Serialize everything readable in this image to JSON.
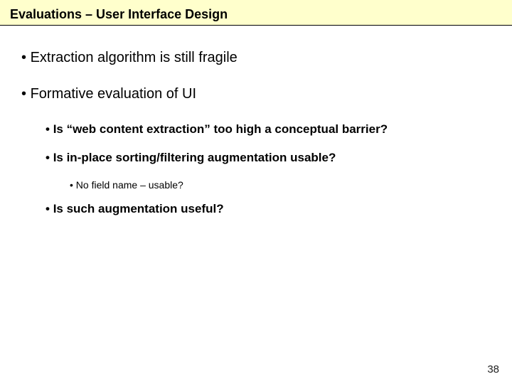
{
  "title": "Evaluations – User Interface Design",
  "bullets": {
    "a": "Extraction algorithm is still fragile",
    "b": "Formative evaluation of UI",
    "b1": "Is “web content extraction” too high a conceptual barrier?",
    "b2": "Is in-place sorting/filtering augmentation usable?",
    "b2a": "No field name – usable?",
    "b3": "Is such augmentation useful?"
  },
  "page_number": "38"
}
